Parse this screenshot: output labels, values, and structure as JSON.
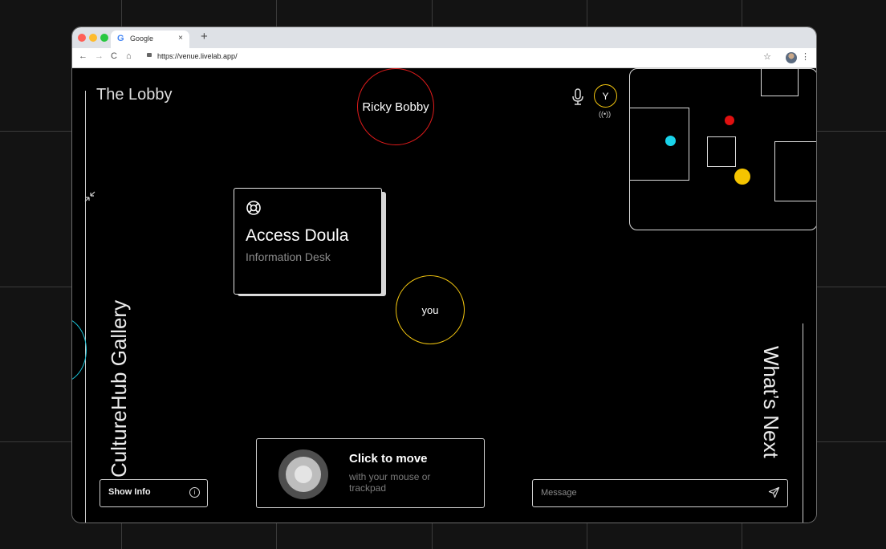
{
  "browser": {
    "tab_title": "Google",
    "tab_favicon": "G",
    "tab_close": "×",
    "new_tab": "+",
    "url": "https://venue.livelab.app/",
    "nav": {
      "back": "←",
      "forward": "→",
      "reload": "C",
      "home": "⌂",
      "star": "☆",
      "menu": "⋮"
    }
  },
  "venue": {
    "room_title": "The Lobby",
    "left_door_label": "CultureHub Gallery",
    "right_door_label": "What’s Next",
    "participants": [
      {
        "name": "Ricky Bobby",
        "ring_color": "#e01b1b"
      },
      {
        "name": "you",
        "ring_color": "#f1c40f"
      }
    ],
    "user_initial": "Y",
    "broadcast_glyph": "((•))",
    "info_card": {
      "icon": "lifebuoy-icon",
      "title": "Access Doula",
      "subtitle": "Information Desk"
    },
    "show_info_label": "Show Info",
    "info_glyph": "i",
    "move_hint": {
      "title": "Click to move",
      "subtitle": "with your mouse or trackpad"
    },
    "message_placeholder": "Message",
    "minimap_dots": [
      {
        "name": "cyan",
        "color": "#19d3ea"
      },
      {
        "name": "red",
        "color": "#e01010"
      },
      {
        "name": "yellow",
        "color": "#f5c400"
      }
    ]
  },
  "colors": {
    "accent_you": "#f1c40f",
    "accent_other": "#e01b1b",
    "accent_cyan": "#19c1d6"
  }
}
